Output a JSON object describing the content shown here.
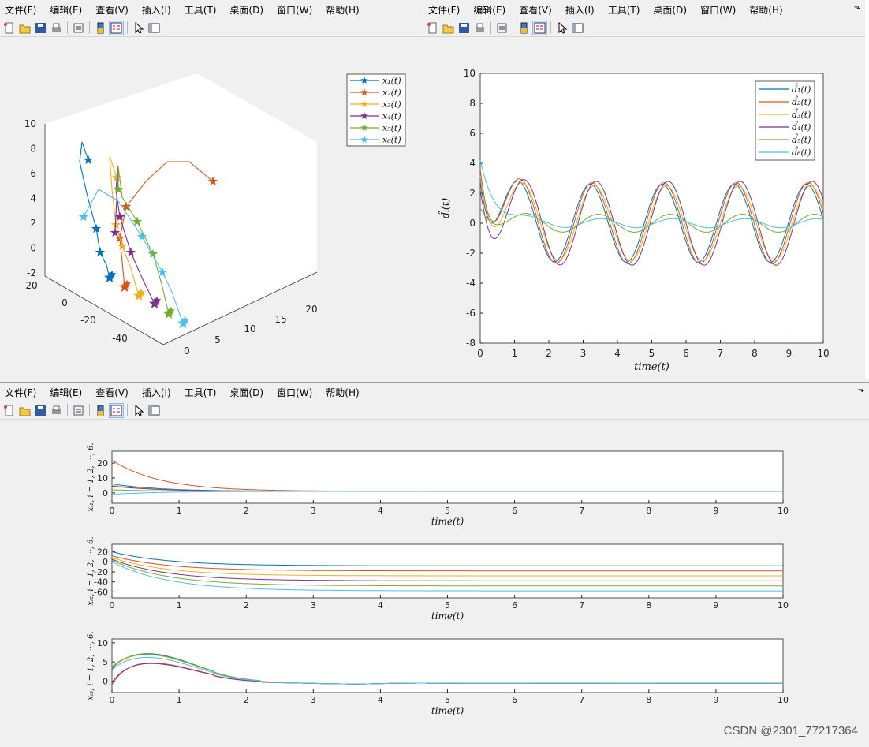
{
  "menu": [
    "文件(F)",
    "编辑(E)",
    "查看(V)",
    "插入(I)",
    "工具(T)",
    "桌面(D)",
    "窗口(W)",
    "帮助(H)"
  ],
  "menu_arrow": "⬎",
  "watermark": "CSDN @2301_77217364",
  "colors": [
    "#0072bd",
    "#d95319",
    "#edb120",
    "#7e2f8e",
    "#77ac30",
    "#4dbeee"
  ],
  "fig3d": {
    "legend": [
      "x₁(t)",
      "x₂(t)",
      "x₃(t)",
      "x₄(t)",
      "x₅(t)",
      "x₆(t)"
    ],
    "z_ticks": [
      "10",
      "8",
      "6",
      "4",
      "2",
      "0",
      "-2"
    ],
    "y_ticks": [
      "20",
      "0",
      "-20",
      "-40"
    ],
    "x_ticks": [
      "0",
      "5",
      "10",
      "15",
      "20"
    ]
  },
  "figd": {
    "legend": [
      "d̂₁(t)",
      "d̂₂(t)",
      "d̂₃(t)",
      "d̂₄(t)",
      "d̂₅(t)",
      "d̂₆(t)"
    ],
    "ylabel": "d̂ᵢ(t)",
    "xlabel": "time(t)",
    "y_ticks": [
      "10",
      "8",
      "6",
      "4",
      "2",
      "0",
      "-2",
      "-4",
      "-6",
      "-8"
    ],
    "x_ticks": [
      "0",
      "1",
      "2",
      "3",
      "4",
      "5",
      "6",
      "7",
      "8",
      "9",
      "10"
    ]
  },
  "figx": {
    "xlabel": "time(t)",
    "x_ticks": [
      "0",
      "1",
      "2",
      "3",
      "4",
      "5",
      "6",
      "7",
      "8",
      "9",
      "10"
    ],
    "sub1": {
      "ylabel": "xᵢ₁, i = 1, 2, ⋯, 6.",
      "y_ticks": [
        "20",
        "10",
        "0"
      ]
    },
    "sub2": {
      "ylabel": "xᵢ₂, i = 1, 2, ⋯, 6.",
      "y_ticks": [
        "20",
        "0",
        "-20",
        "-40",
        "-60"
      ]
    },
    "sub3": {
      "ylabel": "xᵢ₃, i = 1, 2, ⋯, 6.",
      "y_ticks": [
        "10",
        "5",
        "0"
      ]
    }
  },
  "chart_data": [
    {
      "type": "line",
      "title": "",
      "xlabel": "time(t)",
      "ylabel": "d̂ᵢ(t)",
      "xlim": [
        0,
        10
      ],
      "ylim": [
        -8,
        10
      ],
      "legend_position": "top-right",
      "series": [
        {
          "name": "d̂₁(t)",
          "amp": 2.6,
          "phase": 0.1,
          "offset": 0.0,
          "start": 2.8,
          "x": [
            0,
            1,
            2,
            3,
            4,
            5,
            6,
            7,
            8,
            9,
            10
          ]
        },
        {
          "name": "d̂₂(t)",
          "amp": 2.7,
          "phase": 0.25,
          "offset": 0.0,
          "start": 3.6
        },
        {
          "name": "d̂₃(t)",
          "amp": 2.5,
          "phase": 0.45,
          "offset": 0.0,
          "start": 3.2
        },
        {
          "name": "d̂₄(t)",
          "amp": 2.8,
          "phase": 0.6,
          "offset": 0.0,
          "start": 2.2
        },
        {
          "name": "d̂₅(t)",
          "amp": 0.6,
          "phase": 0.8,
          "offset": 0.0,
          "start": 1.0
        },
        {
          "name": "d̂₆(t)",
          "amp": 0.3,
          "phase": 1.0,
          "offset": 0.0,
          "start": 4.2
        }
      ]
    },
    {
      "type": "line",
      "xlabel": "time(t)",
      "ylabel": "xᵢ₁, i = 1, 2, ⋯, 6.",
      "xlim": [
        0,
        10
      ],
      "ylim": [
        -7,
        28
      ],
      "series": [
        {
          "start": 6.0,
          "final": 1.0
        },
        {
          "start": 22.0,
          "final": 1.0
        },
        {
          "start": 5.0,
          "final": 1.0
        },
        {
          "start": 4.5,
          "final": 1.0
        },
        {
          "start": 2.0,
          "final": 1.0
        },
        {
          "start": -1.0,
          "final": 1.0
        }
      ]
    },
    {
      "type": "line",
      "xlabel": "time(t)",
      "ylabel": "xᵢ₂, i = 1, 2, ⋯, 6.",
      "xlim": [
        0,
        10
      ],
      "ylim": [
        -72,
        35
      ],
      "series": [
        {
          "start": 20,
          "final": -8
        },
        {
          "start": 12,
          "final": -18
        },
        {
          "start": 8,
          "final": -28
        },
        {
          "start": 5,
          "final": -38
        },
        {
          "start": 3,
          "final": -48
        },
        {
          "start": 0,
          "final": -58
        }
      ]
    },
    {
      "type": "line",
      "xlabel": "time(t)",
      "ylabel": "xᵢ₃, i = 1, 2, ⋯, 6.",
      "xlim": [
        0,
        10
      ],
      "ylim": [
        -3,
        11
      ],
      "series": [
        {
          "start": 5.5,
          "peak": 8.5
        },
        {
          "start": 1.0,
          "peak": 6.2
        },
        {
          "start": 5.8,
          "peak": 8.2
        },
        {
          "start": 1.5,
          "peak": 6.0
        },
        {
          "start": 6.0,
          "peak": 8.3
        },
        {
          "start": 5.0,
          "peak": 7.5
        }
      ]
    }
  ]
}
